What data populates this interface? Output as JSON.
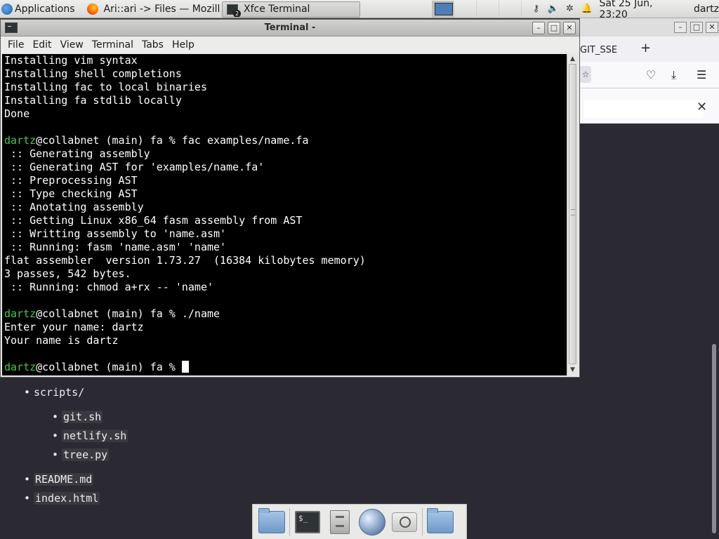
{
  "top_panel": {
    "apps_label": "Applications",
    "tasks": [
      {
        "label": "Ari::ari -> Files — Mozill..."
      },
      {
        "label": "Xfce Terminal",
        "badge": "2"
      }
    ],
    "clock": "Sat 25 Jun, 23:20",
    "user": "dartz"
  },
  "firefox": {
    "tab_label": "GIT_SSE",
    "newtab": "+",
    "close_find": "✕"
  },
  "terminal": {
    "title": "Terminal -",
    "menu": [
      "File",
      "Edit",
      "View",
      "Terminal",
      "Tabs",
      "Help"
    ],
    "lines": [
      {
        "text": "Installing vim syntax"
      },
      {
        "text": "Installing shell completions"
      },
      {
        "text": "Installing fac to local binaries"
      },
      {
        "text": "Installing fa stdlib locally"
      },
      {
        "text": "Done"
      },
      {
        "text": ""
      },
      {
        "user": "dartz",
        "text": "@collabnet (main) fa % fac examples/name.fa"
      },
      {
        "text": " :: Generating assembly"
      },
      {
        "text": " :: Generating AST for 'examples/name.fa'"
      },
      {
        "text": " :: Preprocessing AST"
      },
      {
        "text": " :: Type checking AST"
      },
      {
        "text": " :: Anotating assembly"
      },
      {
        "text": " :: Getting Linux x86_64 fasm assembly from AST"
      },
      {
        "text": " :: Writting assembly to 'name.asm'"
      },
      {
        "text": " :: Running: fasm 'name.asm' 'name'"
      },
      {
        "text": "flat assembler  version 1.73.27  (16384 kilobytes memory)"
      },
      {
        "text": "3 passes, 542 bytes."
      },
      {
        "text": " :: Running: chmod a+rx -- 'name'"
      },
      {
        "text": ""
      },
      {
        "user": "dartz",
        "text": "@collabnet (main) fa % ./name"
      },
      {
        "text": "Enter your name: dartz"
      },
      {
        "text": "Your name is dartz"
      },
      {
        "text": ""
      },
      {
        "user": "dartz",
        "text": "@collabnet (main) fa % ",
        "cursor": true
      }
    ]
  },
  "page": {
    "list": [
      {
        "label": "scripts/",
        "level": 0,
        "code": false
      },
      {
        "label": "git.sh",
        "level": 1,
        "code": true
      },
      {
        "label": "netlify.sh",
        "level": 1,
        "code": true
      },
      {
        "label": "tree.py",
        "level": 1,
        "code": true
      },
      {
        "label": "README.md",
        "level": 0,
        "code": true
      },
      {
        "label": "index.html",
        "level": 0,
        "code": true
      }
    ]
  },
  "dock": {
    "items": [
      "home-folder",
      "terminal",
      "file-manager",
      "web-browser",
      "app-finder",
      "folder"
    ]
  }
}
